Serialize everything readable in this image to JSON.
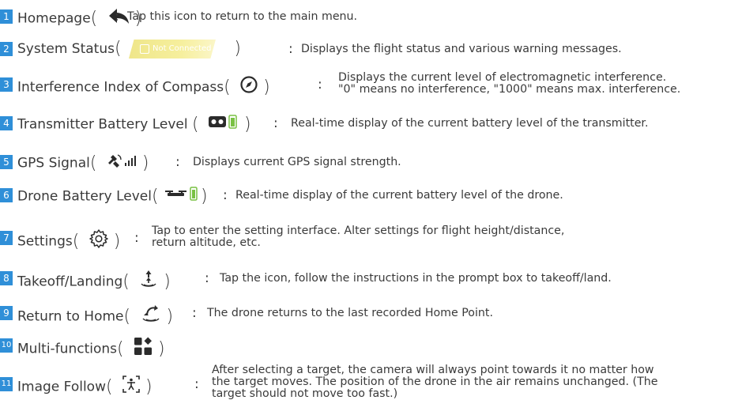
{
  "colors": {
    "number_badge": "#2f8fd8",
    "status_badge": "#f3ea8f"
  },
  "items": [
    {
      "num": "1",
      "name": "Homepage",
      "icon": "back-arrow-icon",
      "desc": [
        "Tap this icon to return to the main menu."
      ]
    },
    {
      "num": "2",
      "name": "System Status",
      "icon": "status-badge",
      "badge_text": "Not Connected",
      "desc": [
        "Displays the flight status and various warning messages."
      ]
    },
    {
      "num": "3",
      "name": "Interference Index of Compass",
      "icon": "compass-icon",
      "desc": [
        "Displays the current level of electromagnetic interference.",
        "\"0\" means no interference, \"1000\" means max. interference."
      ]
    },
    {
      "num": "4",
      "name": "Transmitter Battery Level",
      "icon": "transmitter-battery-icon",
      "desc": [
        "Real-time display of the current battery level of the transmitter."
      ]
    },
    {
      "num": "5",
      "name": "GPS Signal",
      "icon": "gps-signal-icon",
      "desc": [
        "Displays current GPS signal strength."
      ]
    },
    {
      "num": "6",
      "name": "Drone Battery Level",
      "icon": "drone-battery-icon",
      "desc": [
        "Real-time display of the current battery level of the drone."
      ]
    },
    {
      "num": "7",
      "name": "Settings",
      "icon": "gear-icon",
      "desc": [
        "Tap to enter the setting interface. Alter settings for flight height/distance,",
        "return altitude, etc."
      ]
    },
    {
      "num": "8",
      "name": "Takeoff/Landing",
      "icon": "takeoff-landing-icon",
      "desc": [
        "Tap the icon, follow the instructions in the prompt box to takeoff/land."
      ]
    },
    {
      "num": "9",
      "name": "Return to Home",
      "icon": "return-home-icon",
      "desc": [
        "The drone returns to the last recorded Home Point."
      ]
    },
    {
      "num": "10",
      "name": "Multi-functions",
      "icon": "multi-functions-icon",
      "desc": []
    },
    {
      "num": "11",
      "name": "Image Follow",
      "icon": "image-follow-icon",
      "desc": [
        "After selecting a target, the camera will always point towards it no matter how",
        "the target moves. The position of the drone in the air remains unchanged. (The",
        "target should not move too fast.)"
      ]
    }
  ]
}
